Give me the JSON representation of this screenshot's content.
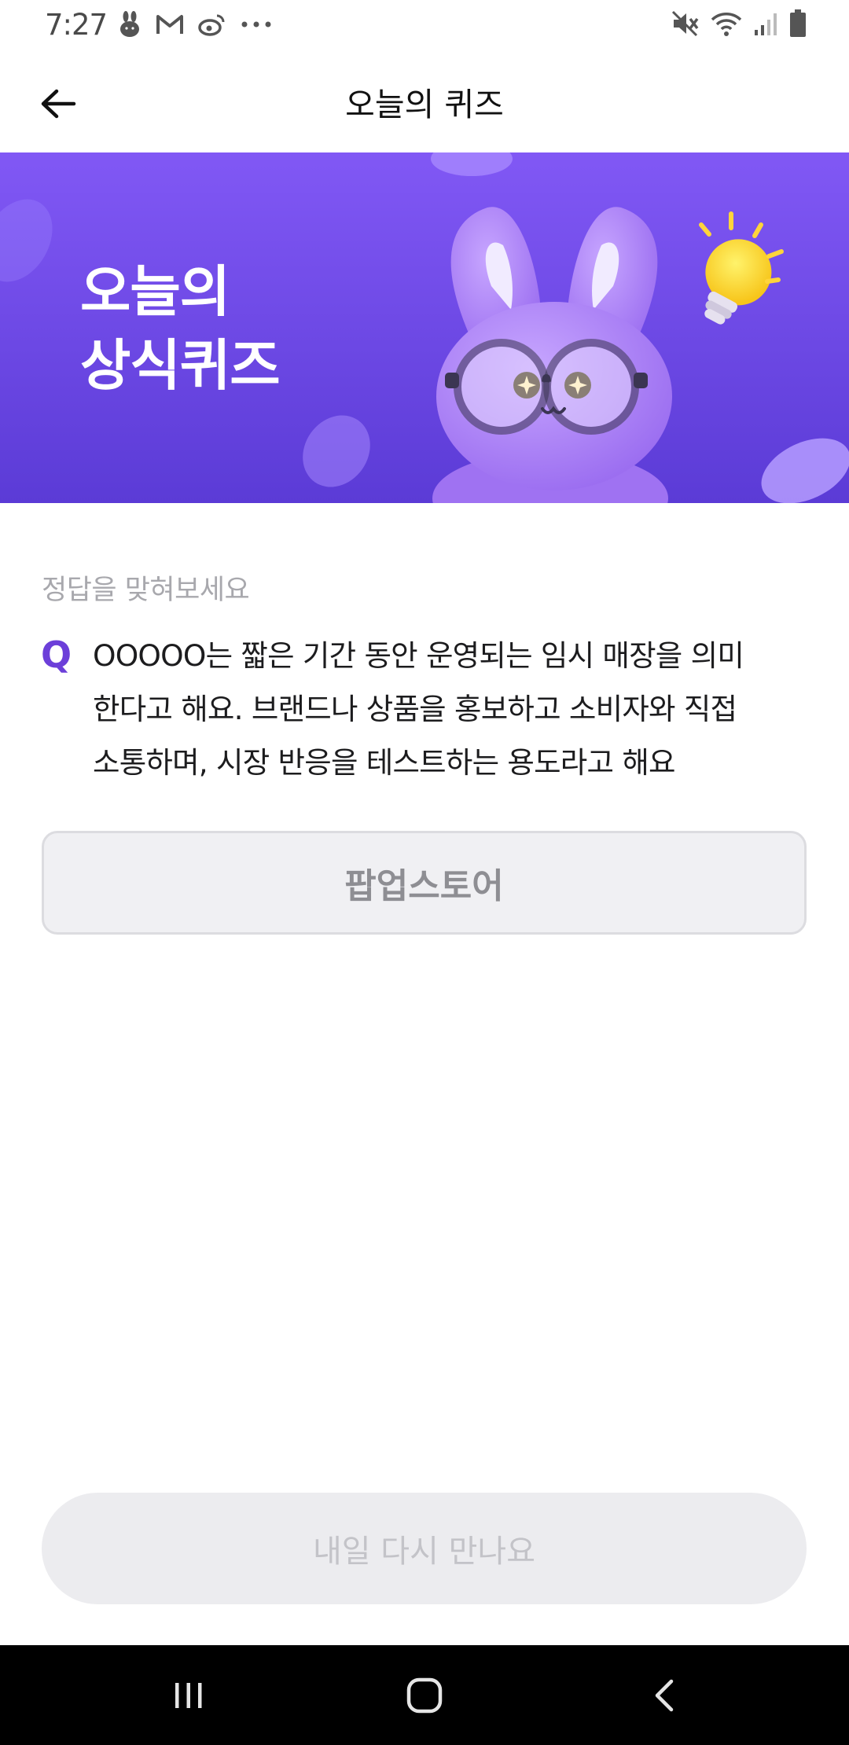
{
  "status_bar": {
    "time": "7:27",
    "left_icons": [
      "rabbit-app-icon",
      "gmail-icon",
      "weibo-icon",
      "more-dots-icon"
    ],
    "right_icons": [
      "mute-icon",
      "wifi-icon",
      "signal-icon",
      "battery-icon"
    ]
  },
  "header": {
    "title": "오늘의 퀴즈",
    "back_icon": "arrow-left-icon"
  },
  "banner": {
    "title_line1": "오늘의",
    "title_line2": "상식퀴즈",
    "colors": {
      "top": "#8158f5",
      "bottom": "#5b3bd6"
    }
  },
  "quiz": {
    "hint": "정답을 맞혀보세요",
    "q_mark": "Q",
    "question_line1": "OOOOO는 짧은 기간 동안 운영되는 임시 매장을 의미",
    "question_line2": "한다고 해요. 브랜드나 상품을 홍보하고 소비자와 직접",
    "question_line3": "소통하며, 시장 반응을 테스트하는 용도라고 해요",
    "answer": "팝업스토어"
  },
  "cta": {
    "label": "내일 다시 만나요"
  },
  "nav_bar": {
    "icons": [
      "recent-apps-icon",
      "home-icon",
      "back-icon"
    ]
  },
  "colors": {
    "accent": "#6c3fd9",
    "answer_bg": "#f0f0f3",
    "cta_bg": "#ececef"
  }
}
